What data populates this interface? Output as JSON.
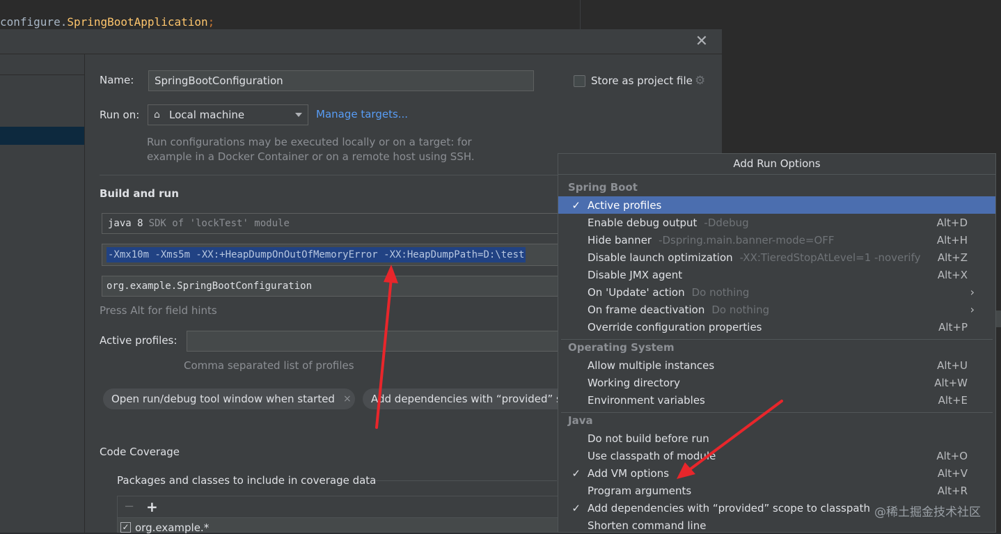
{
  "editor": {
    "code_prefix": "configure.",
    "code_class": "SpringBootApplication",
    "code_suffix": ";"
  },
  "dialog": {
    "close_glyph": "✕",
    "name_label": "Name:",
    "name_value": "SpringBootConfiguration",
    "store_label": "Store as project file",
    "runon_label": "Run on:",
    "runon_value": "Local machine",
    "manage_targets": "Manage targets...",
    "runon_desc": "Run configurations may be executed locally or on a target: for example in a Docker Container or on a remote host using SSH.",
    "build_heading": "Build and run",
    "sdk_java": "java 8",
    "sdk_module": "SDK of 'lockTest' module",
    "vm_options": "-Xmx10m -Xms5m -XX:+HeapDumpOnOutOfMemoryError -XX:HeapDumpPath=D:\\test",
    "main_class": "org.example.SpringBootConfiguration",
    "field_hint": "Press Alt for field hints",
    "profiles_label": "Active profiles:",
    "profiles_value": "",
    "profiles_hint": "Comma separated list of profiles",
    "chip_open_tool": "Open run/debug tool window when started",
    "chip_close": "×",
    "chip_add_deps": "Add dependencies with “provided” scope to classpath",
    "coverage_heading": "Code Coverage",
    "packages_label": "Packages and classes to include in coverage data",
    "coverage_pattern": "org.example.*"
  },
  "popup": {
    "title": "Add Run Options",
    "groups": [
      {
        "name": "Spring Boot",
        "options": [
          {
            "label": "Active profiles",
            "sub": "",
            "shortcut": "",
            "checked": true,
            "active": true,
            "submenu": false
          },
          {
            "label": "Enable debug output",
            "sub": "-Ddebug",
            "shortcut": "Alt+D",
            "checked": false,
            "active": false,
            "submenu": false
          },
          {
            "label": "Hide banner",
            "sub": "-Dspring.main.banner-mode=OFF",
            "shortcut": "Alt+H",
            "checked": false,
            "active": false,
            "submenu": false
          },
          {
            "label": "Disable launch optimization",
            "sub": "-XX:TieredStopAtLevel=1 -noverify",
            "shortcut": "Alt+Z",
            "checked": false,
            "active": false,
            "submenu": false
          },
          {
            "label": "Disable JMX agent",
            "sub": "",
            "shortcut": "Alt+X",
            "checked": false,
            "active": false,
            "submenu": false
          },
          {
            "label": "On 'Update' action",
            "sub": "Do nothing",
            "shortcut": "",
            "checked": false,
            "active": false,
            "submenu": true
          },
          {
            "label": "On frame deactivation",
            "sub": "Do nothing",
            "shortcut": "",
            "checked": false,
            "active": false,
            "submenu": true
          },
          {
            "label": "Override configuration properties",
            "sub": "",
            "shortcut": "Alt+P",
            "checked": false,
            "active": false,
            "submenu": false
          }
        ]
      },
      {
        "name": "Operating System",
        "options": [
          {
            "label": "Allow multiple instances",
            "sub": "",
            "shortcut": "Alt+U",
            "checked": false,
            "active": false,
            "submenu": false
          },
          {
            "label": "Working directory",
            "sub": "",
            "shortcut": "Alt+W",
            "checked": false,
            "active": false,
            "submenu": false
          },
          {
            "label": "Environment variables",
            "sub": "",
            "shortcut": "Alt+E",
            "checked": false,
            "active": false,
            "submenu": false
          }
        ]
      },
      {
        "name": "Java",
        "options": [
          {
            "label": "Do not build before run",
            "sub": "",
            "shortcut": "",
            "checked": false,
            "active": false,
            "submenu": false
          },
          {
            "label": "Use classpath of module",
            "sub": "",
            "shortcut": "Alt+O",
            "checked": false,
            "active": false,
            "submenu": false
          },
          {
            "label": "Add VM options",
            "sub": "",
            "shortcut": "Alt+V",
            "checked": true,
            "active": false,
            "submenu": false
          },
          {
            "label": "Program arguments",
            "sub": "",
            "shortcut": "Alt+R",
            "checked": false,
            "active": false,
            "submenu": false
          },
          {
            "label": "Add dependencies with “provided” scope to classpath",
            "sub": "",
            "shortcut": "",
            "checked": true,
            "active": false,
            "submenu": false
          },
          {
            "label": "Shorten command line",
            "sub": "",
            "shortcut": "",
            "checked": false,
            "active": false,
            "submenu": false
          }
        ]
      }
    ]
  },
  "watermark": "@稀土掘金技术社区",
  "colors": {
    "accent": "#4b6eaf",
    "link": "#589df6",
    "selection": "#214283",
    "annotation_arrow": "#e8262b"
  }
}
